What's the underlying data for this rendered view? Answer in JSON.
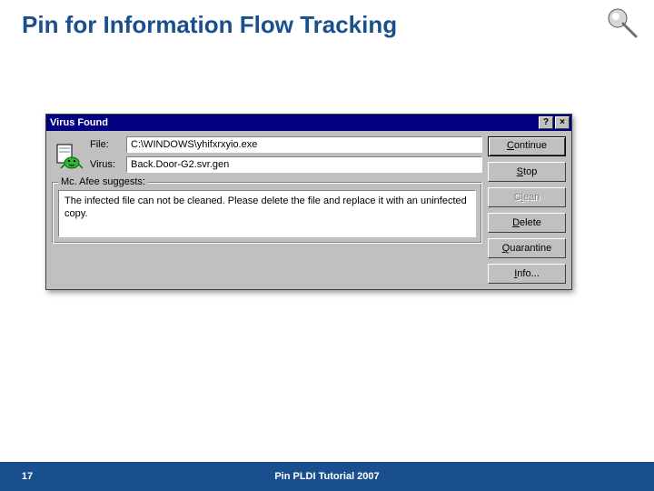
{
  "slide": {
    "title": "Pin for Information Flow Tracking",
    "page_number": "17",
    "footer": "Pin PLDI Tutorial 2007"
  },
  "dialog": {
    "title": "Virus Found",
    "file_label": "File:",
    "file_value": "C:\\WINDOWS\\yhifxrxyio.exe",
    "virus_label": "Virus:",
    "virus_value": "Back.Door-G2.svr.gen",
    "suggest_legend": "Mc. Afee suggests:",
    "suggest_text": "The infected file can not be cleaned. Please delete the file and replace it with an uninfected copy.",
    "buttons": {
      "continue": "Continue",
      "stop": "Stop",
      "clean": "Clean",
      "delete": "Delete",
      "quarantine": "Quarantine",
      "info": "Info..."
    },
    "help_btn": "?",
    "close_btn": "×"
  }
}
